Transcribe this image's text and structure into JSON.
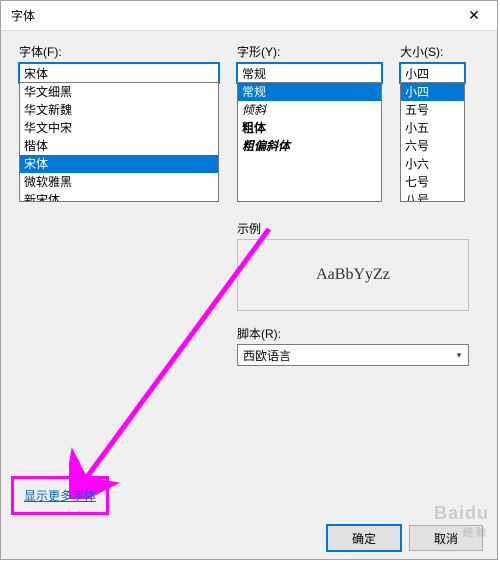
{
  "title": "字体",
  "close_glyph": "✕",
  "font": {
    "label": "字体(F):",
    "value": "宋体",
    "items": [
      "华文细黑",
      "华文新魏",
      "华文中宋",
      "楷体",
      "宋体",
      "微软雅黑",
      "新宋体"
    ],
    "selected_index": 4
  },
  "style": {
    "label": "字形(Y):",
    "value": "常规",
    "items": [
      "常规",
      "倾斜",
      "粗体",
      "粗偏斜体"
    ],
    "selected_index": 0,
    "classes": [
      "",
      "it-italic",
      "it-bold",
      "it-bolditalic"
    ]
  },
  "size": {
    "label": "大小(S):",
    "value": "小四",
    "items": [
      "小四",
      "五号",
      "小五",
      "六号",
      "小六",
      "七号",
      "八号"
    ],
    "selected_index": 0
  },
  "sample": {
    "label": "示例",
    "text": "AaBbYyZz"
  },
  "script": {
    "label": "脚本(R):",
    "value": "西欧语言"
  },
  "link_text": "显示更多字体",
  "ok": "确定",
  "cancel": "取消",
  "watermark": "Baidu",
  "watermark_sub": "经验"
}
